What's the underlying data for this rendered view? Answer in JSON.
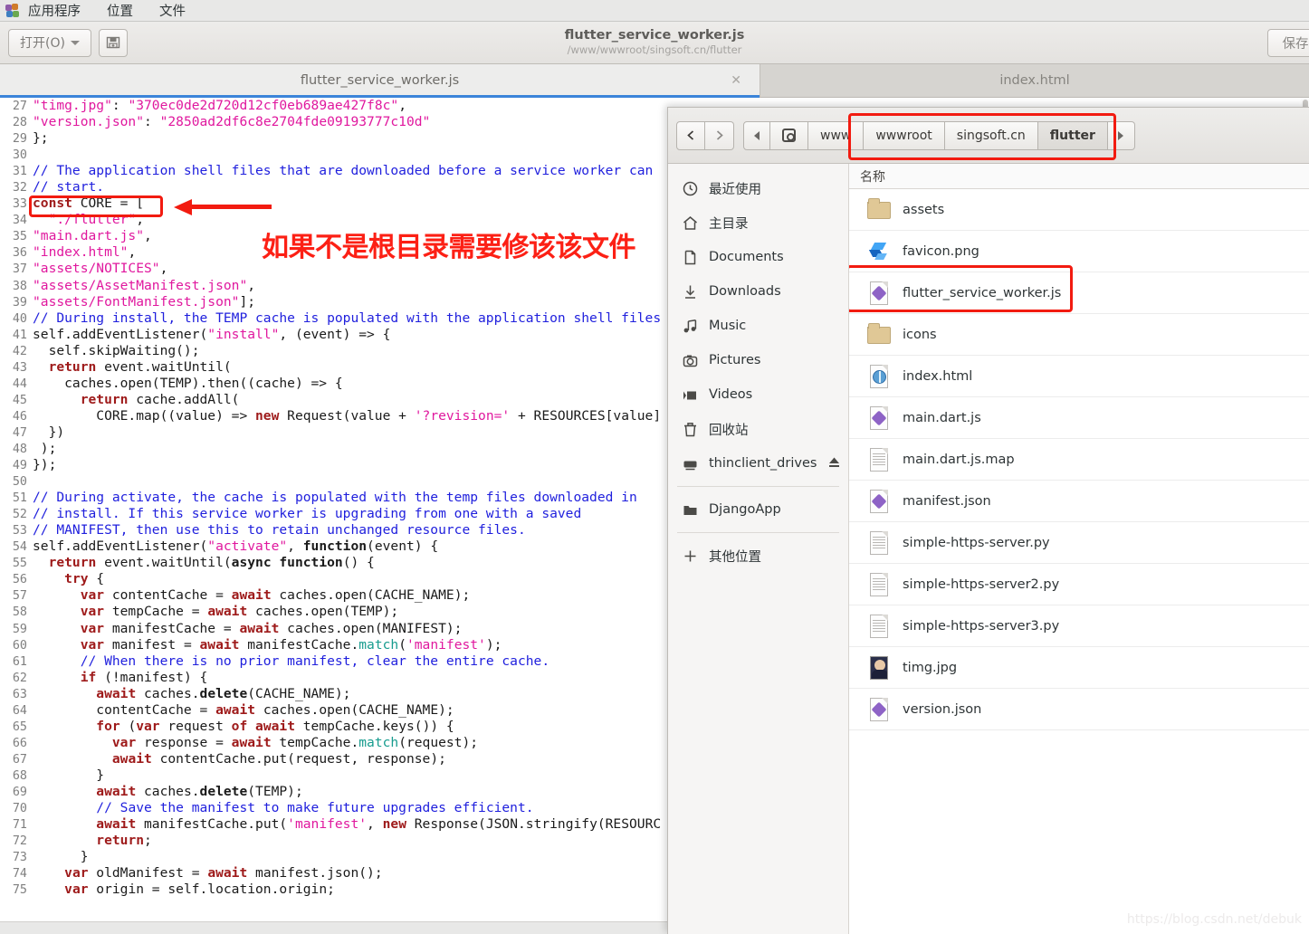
{
  "desktop": {
    "menubar": {
      "logo_icon": "gnome-foot-icon",
      "items": [
        {
          "label": "应用程序"
        },
        {
          "label": "位置"
        },
        {
          "label": "文件"
        }
      ]
    }
  },
  "editor": {
    "headerbar": {
      "open_label": "打开(O)",
      "open_icon": "chevron-down-icon",
      "save_icon_button": "save-disk-icon",
      "title": "flutter_service_worker.js",
      "subtitle": "/www/wwwroot/singsoft.cn/flutter",
      "save_label": "保存"
    },
    "tabs": [
      {
        "label": "flutter_service_worker.js",
        "close_icon": "close-icon",
        "active": true
      },
      {
        "label": "index.html",
        "active": false
      }
    ],
    "first_line_number": 27,
    "lines": [
      {
        "n": 27,
        "tokens": [
          {
            "t": "str",
            "v": "\"timg.jpg\""
          },
          {
            "t": "pln",
            "v": ": "
          },
          {
            "t": "str",
            "v": "\"370ec0de2d720d12cf0eb689ae427f8c\""
          },
          {
            "t": "pln",
            "v": ","
          }
        ]
      },
      {
        "n": 28,
        "tokens": [
          {
            "t": "str",
            "v": "\"version.json\""
          },
          {
            "t": "pln",
            "v": ": "
          },
          {
            "t": "str",
            "v": "\"2850ad2df6c8e2704fde09193777c10d\""
          }
        ]
      },
      {
        "n": 29,
        "tokens": [
          {
            "t": "pln",
            "v": "};"
          }
        ]
      },
      {
        "n": 30,
        "tokens": [
          {
            "t": "pln",
            "v": ""
          }
        ]
      },
      {
        "n": 31,
        "tokens": [
          {
            "t": "cmt",
            "v": "// The application shell files that are downloaded before a service worker can"
          }
        ]
      },
      {
        "n": 32,
        "tokens": [
          {
            "t": "cmt",
            "v": "// start."
          }
        ]
      },
      {
        "n": 33,
        "tokens": [
          {
            "t": "kw",
            "v": "const"
          },
          {
            "t": "pln",
            "v": " CORE = ["
          }
        ]
      },
      {
        "n": 34,
        "tokens": [
          {
            "t": "pln",
            "v": "  "
          },
          {
            "t": "str",
            "v": "\"./flutter\""
          },
          {
            "t": "pln",
            "v": ","
          }
        ]
      },
      {
        "n": 35,
        "tokens": [
          {
            "t": "str",
            "v": "\"main.dart.js\""
          },
          {
            "t": "pln",
            "v": ","
          }
        ]
      },
      {
        "n": 36,
        "tokens": [
          {
            "t": "str",
            "v": "\"index.html\""
          },
          {
            "t": "pln",
            "v": ","
          }
        ]
      },
      {
        "n": 37,
        "tokens": [
          {
            "t": "str",
            "v": "\"assets/NOTICES\""
          },
          {
            "t": "pln",
            "v": ","
          }
        ]
      },
      {
        "n": 38,
        "tokens": [
          {
            "t": "str",
            "v": "\"assets/AssetManifest.json\""
          },
          {
            "t": "pln",
            "v": ","
          }
        ]
      },
      {
        "n": 39,
        "tokens": [
          {
            "t": "str",
            "v": "\"assets/FontManifest.json\""
          },
          {
            "t": "pln",
            "v": "];"
          }
        ]
      },
      {
        "n": 40,
        "tokens": [
          {
            "t": "cmt",
            "v": "// During install, the TEMP cache is populated with the application shell files"
          }
        ]
      },
      {
        "n": 41,
        "tokens": [
          {
            "t": "pln",
            "v": "self.addEventListener("
          },
          {
            "t": "str",
            "v": "\"install\""
          },
          {
            "t": "pln",
            "v": ", (event) => {"
          }
        ]
      },
      {
        "n": 42,
        "tokens": [
          {
            "t": "pln",
            "v": "  self.skipWaiting();"
          }
        ]
      },
      {
        "n": 43,
        "tokens": [
          {
            "t": "pln",
            "v": "  "
          },
          {
            "t": "kw",
            "v": "return"
          },
          {
            "t": "pln",
            "v": " event.waitUntil("
          }
        ]
      },
      {
        "n": 44,
        "tokens": [
          {
            "t": "pln",
            "v": "    caches.open(TEMP).then((cache) => {"
          }
        ]
      },
      {
        "n": 45,
        "tokens": [
          {
            "t": "pln",
            "v": "      "
          },
          {
            "t": "kw",
            "v": "return"
          },
          {
            "t": "pln",
            "v": " cache.addAll("
          }
        ]
      },
      {
        "n": 46,
        "tokens": [
          {
            "t": "pln",
            "v": "        CORE.map((value) => "
          },
          {
            "t": "kw",
            "v": "new"
          },
          {
            "t": "pln",
            "v": " Request(value + "
          },
          {
            "t": "str",
            "v": "'?revision='"
          },
          {
            "t": "pln",
            "v": " + RESOURCES[value]"
          }
        ]
      },
      {
        "n": 47,
        "tokens": [
          {
            "t": "pln",
            "v": "  })"
          }
        ]
      },
      {
        "n": 48,
        "tokens": [
          {
            "t": "pln",
            "v": " );"
          }
        ]
      },
      {
        "n": 49,
        "tokens": [
          {
            "t": "pln",
            "v": "});"
          }
        ]
      },
      {
        "n": 50,
        "tokens": [
          {
            "t": "pln",
            "v": ""
          }
        ]
      },
      {
        "n": 51,
        "tokens": [
          {
            "t": "cmt",
            "v": "// During activate, the cache is populated with the temp files downloaded in"
          }
        ]
      },
      {
        "n": 52,
        "tokens": [
          {
            "t": "cmt",
            "v": "// install. If this service worker is upgrading from one with a saved"
          }
        ]
      },
      {
        "n": 53,
        "tokens": [
          {
            "t": "cmt",
            "v": "// MANIFEST, then use this to retain unchanged resource files."
          }
        ]
      },
      {
        "n": 54,
        "tokens": [
          {
            "t": "pln",
            "v": "self.addEventListener("
          },
          {
            "t": "str",
            "v": "\"activate\""
          },
          {
            "t": "pln",
            "v": ", "
          },
          {
            "t": "bld",
            "v": "function"
          },
          {
            "t": "pln",
            "v": "(event) {"
          }
        ]
      },
      {
        "n": 55,
        "tokens": [
          {
            "t": "pln",
            "v": "  "
          },
          {
            "t": "kw",
            "v": "return"
          },
          {
            "t": "pln",
            "v": " event.waitUntil("
          },
          {
            "t": "bld",
            "v": "async function"
          },
          {
            "t": "pln",
            "v": "() {"
          }
        ]
      },
      {
        "n": 56,
        "tokens": [
          {
            "t": "pln",
            "v": "    "
          },
          {
            "t": "kw",
            "v": "try"
          },
          {
            "t": "pln",
            "v": " {"
          }
        ]
      },
      {
        "n": 57,
        "tokens": [
          {
            "t": "pln",
            "v": "      "
          },
          {
            "t": "kw",
            "v": "var"
          },
          {
            "t": "pln",
            "v": " contentCache = "
          },
          {
            "t": "kw",
            "v": "await"
          },
          {
            "t": "pln",
            "v": " caches.open(CACHE_NAME);"
          }
        ]
      },
      {
        "n": 58,
        "tokens": [
          {
            "t": "pln",
            "v": "      "
          },
          {
            "t": "kw",
            "v": "var"
          },
          {
            "t": "pln",
            "v": " tempCache = "
          },
          {
            "t": "kw",
            "v": "await"
          },
          {
            "t": "pln",
            "v": " caches.open(TEMP);"
          }
        ]
      },
      {
        "n": 59,
        "tokens": [
          {
            "t": "pln",
            "v": "      "
          },
          {
            "t": "kw",
            "v": "var"
          },
          {
            "t": "pln",
            "v": " manifestCache = "
          },
          {
            "t": "kw",
            "v": "await"
          },
          {
            "t": "pln",
            "v": " caches.open(MANIFEST);"
          }
        ]
      },
      {
        "n": 60,
        "tokens": [
          {
            "t": "pln",
            "v": "      "
          },
          {
            "t": "kw",
            "v": "var"
          },
          {
            "t": "pln",
            "v": " manifest = "
          },
          {
            "t": "kw",
            "v": "await"
          },
          {
            "t": "pln",
            "v": " manifestCache."
          },
          {
            "t": "fn",
            "v": "match"
          },
          {
            "t": "pln",
            "v": "("
          },
          {
            "t": "str",
            "v": "'manifest'"
          },
          {
            "t": "pln",
            "v": ");"
          }
        ]
      },
      {
        "n": 61,
        "tokens": [
          {
            "t": "pln",
            "v": "      "
          },
          {
            "t": "cmt",
            "v": "// When there is no prior manifest, clear the entire cache."
          }
        ]
      },
      {
        "n": 62,
        "tokens": [
          {
            "t": "pln",
            "v": "      "
          },
          {
            "t": "kw",
            "v": "if"
          },
          {
            "t": "pln",
            "v": " (!manifest) {"
          }
        ]
      },
      {
        "n": 63,
        "tokens": [
          {
            "t": "pln",
            "v": "        "
          },
          {
            "t": "kw",
            "v": "await"
          },
          {
            "t": "pln",
            "v": " caches."
          },
          {
            "t": "bld",
            "v": "delete"
          },
          {
            "t": "pln",
            "v": "(CACHE_NAME);"
          }
        ]
      },
      {
        "n": 64,
        "tokens": [
          {
            "t": "pln",
            "v": "        contentCache = "
          },
          {
            "t": "kw",
            "v": "await"
          },
          {
            "t": "pln",
            "v": " caches.open(CACHE_NAME);"
          }
        ]
      },
      {
        "n": 65,
        "tokens": [
          {
            "t": "pln",
            "v": "        "
          },
          {
            "t": "kw",
            "v": "for"
          },
          {
            "t": "pln",
            "v": " ("
          },
          {
            "t": "kw",
            "v": "var"
          },
          {
            "t": "pln",
            "v": " request "
          },
          {
            "t": "kw",
            "v": "of"
          },
          {
            "t": "pln",
            "v": " "
          },
          {
            "t": "kw",
            "v": "await"
          },
          {
            "t": "pln",
            "v": " tempCache.keys()) {"
          }
        ]
      },
      {
        "n": 66,
        "tokens": [
          {
            "t": "pln",
            "v": "          "
          },
          {
            "t": "kw",
            "v": "var"
          },
          {
            "t": "pln",
            "v": " response = "
          },
          {
            "t": "kw",
            "v": "await"
          },
          {
            "t": "pln",
            "v": " tempCache."
          },
          {
            "t": "fn",
            "v": "match"
          },
          {
            "t": "pln",
            "v": "(request);"
          }
        ]
      },
      {
        "n": 67,
        "tokens": [
          {
            "t": "pln",
            "v": "          "
          },
          {
            "t": "kw",
            "v": "await"
          },
          {
            "t": "pln",
            "v": " contentCache.put(request, response);"
          }
        ]
      },
      {
        "n": 68,
        "tokens": [
          {
            "t": "pln",
            "v": "        }"
          }
        ]
      },
      {
        "n": 69,
        "tokens": [
          {
            "t": "pln",
            "v": "        "
          },
          {
            "t": "kw",
            "v": "await"
          },
          {
            "t": "pln",
            "v": " caches."
          },
          {
            "t": "bld",
            "v": "delete"
          },
          {
            "t": "pln",
            "v": "(TEMP);"
          }
        ]
      },
      {
        "n": 70,
        "tokens": [
          {
            "t": "pln",
            "v": "        "
          },
          {
            "t": "cmt",
            "v": "// Save the manifest to make future upgrades efficient."
          }
        ]
      },
      {
        "n": 71,
        "tokens": [
          {
            "t": "pln",
            "v": "        "
          },
          {
            "t": "kw",
            "v": "await"
          },
          {
            "t": "pln",
            "v": " manifestCache.put("
          },
          {
            "t": "str",
            "v": "'manifest'"
          },
          {
            "t": "pln",
            "v": ", "
          },
          {
            "t": "kw",
            "v": "new"
          },
          {
            "t": "pln",
            "v": " Response(JSON.stringify(RESOURC"
          }
        ]
      },
      {
        "n": 72,
        "tokens": [
          {
            "t": "pln",
            "v": "        "
          },
          {
            "t": "kw",
            "v": "return"
          },
          {
            "t": "pln",
            "v": ";"
          }
        ]
      },
      {
        "n": 73,
        "tokens": [
          {
            "t": "pln",
            "v": "      }"
          }
        ]
      },
      {
        "n": 74,
        "tokens": [
          {
            "t": "pln",
            "v": "    "
          },
          {
            "t": "kw",
            "v": "var"
          },
          {
            "t": "pln",
            "v": " oldManifest = "
          },
          {
            "t": "kw",
            "v": "await"
          },
          {
            "t": "pln",
            "v": " manifest.json();"
          }
        ]
      },
      {
        "n": 75,
        "tokens": [
          {
            "t": "pln",
            "v": "    "
          },
          {
            "t": "kw",
            "v": "var"
          },
          {
            "t": "pln",
            "v": " origin = self.location.origin;"
          }
        ]
      }
    ]
  },
  "annotations": {
    "highlight_color": "#f21b10",
    "note_text": "如果不是根目录需要修该该文件",
    "boxes": [
      {
        "name": "flutter-path-line-highlight"
      },
      {
        "name": "breadcrumb-highlight"
      },
      {
        "name": "file-row-highlight"
      }
    ]
  },
  "filedialog": {
    "nav": {
      "back_icon": "chevron-left-icon",
      "forward_icon": "chevron-right-icon"
    },
    "breadcrumbs": [
      {
        "label": "",
        "icon": "arrow-left-icon",
        "type": "scroll"
      },
      {
        "label": "",
        "icon": "disk-icon",
        "type": "root"
      },
      {
        "label": "www",
        "type": "path"
      },
      {
        "label": "wwwroot",
        "type": "path"
      },
      {
        "label": "singsoft.cn",
        "type": "path"
      },
      {
        "label": "flutter",
        "type": "current"
      },
      {
        "label": "",
        "icon": "arrow-right-icon",
        "type": "scroll"
      }
    ],
    "sidebar": [
      {
        "label": "最近使用",
        "icon": "clock-icon"
      },
      {
        "label": "主目录",
        "icon": "home-icon"
      },
      {
        "label": "Documents",
        "icon": "document-icon"
      },
      {
        "label": "Downloads",
        "icon": "download-icon"
      },
      {
        "label": "Music",
        "icon": "music-note-icon"
      },
      {
        "label": "Pictures",
        "icon": "camera-icon"
      },
      {
        "label": "Videos",
        "icon": "video-icon"
      },
      {
        "label": "回收站",
        "icon": "trash-icon"
      },
      {
        "label": "thinclient_drives",
        "icon": "drive-icon",
        "eject_icon": "eject-icon"
      },
      {
        "label": "DjangoApp",
        "icon": "folder-icon",
        "separator_before": true
      },
      {
        "label": "其他位置",
        "icon": "plus-icon",
        "separator_before": true
      }
    ],
    "list_header": "名称",
    "files": [
      {
        "name": "assets",
        "icon": "folder-icon"
      },
      {
        "name": "favicon.png",
        "icon": "flutter-logo-icon"
      },
      {
        "name": "flutter_service_worker.js",
        "icon": "js-gem-icon",
        "highlighted": true
      },
      {
        "name": "icons",
        "icon": "folder-icon"
      },
      {
        "name": "index.html",
        "icon": "html-globe-icon"
      },
      {
        "name": "main.dart.js",
        "icon": "js-gem-icon"
      },
      {
        "name": "main.dart.js.map",
        "icon": "text-file-icon"
      },
      {
        "name": "manifest.json",
        "icon": "js-gem-icon"
      },
      {
        "name": "simple-https-server.py",
        "icon": "text-file-icon"
      },
      {
        "name": "simple-https-server2.py",
        "icon": "text-file-icon"
      },
      {
        "name": "simple-https-server3.py",
        "icon": "text-file-icon"
      },
      {
        "name": "timg.jpg",
        "icon": "image-thumbnail-icon"
      },
      {
        "name": "version.json",
        "icon": "js-gem-icon"
      }
    ]
  },
  "watermark": "https://blog.csdn.net/debuk"
}
